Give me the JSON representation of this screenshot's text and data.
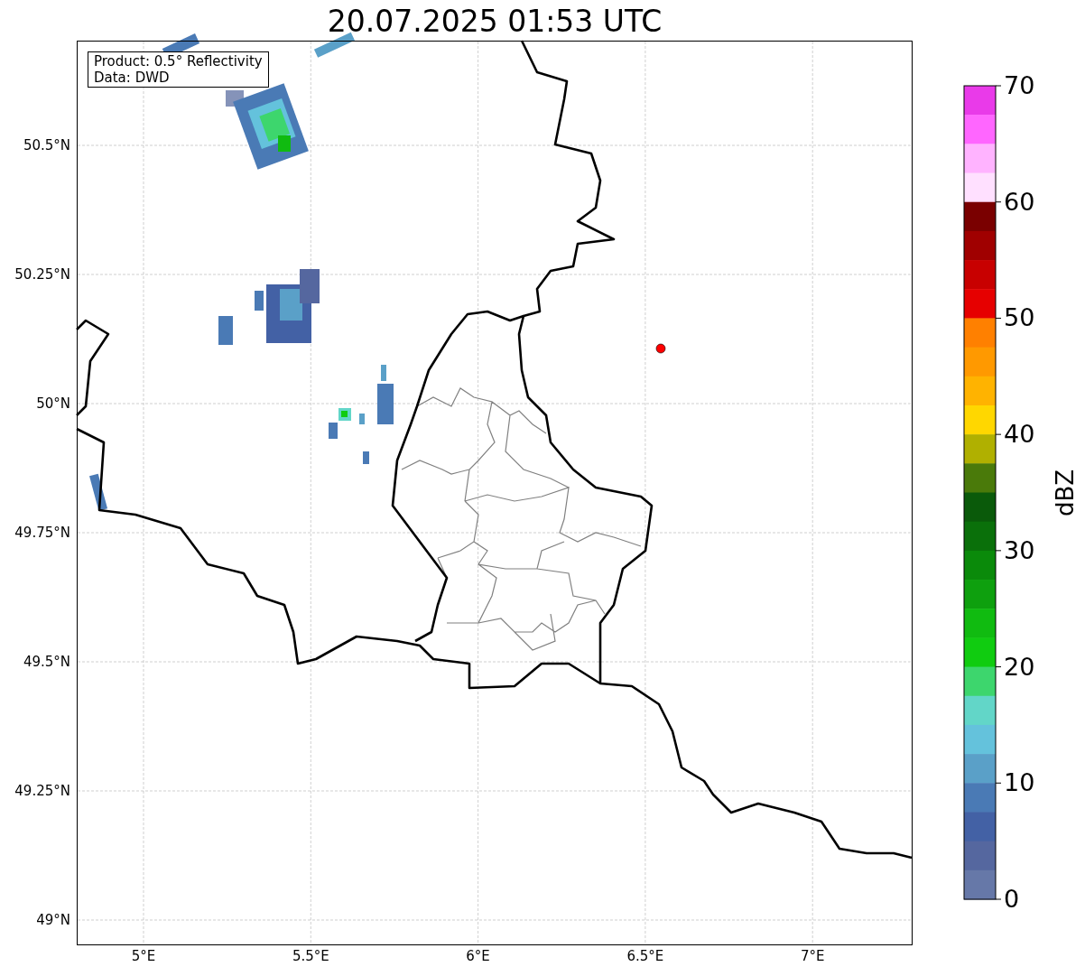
{
  "title": "20.07.2025 01:53 UTC",
  "info_box": {
    "lines": [
      "Product: 0.5° Reflectivity",
      "Data: DWD"
    ]
  },
  "map": {
    "lat_labels": [
      "50.5°N",
      "50.25°N",
      "50°N",
      "49.75°N",
      "49.5°N",
      "49.25°N",
      "49°N"
    ],
    "lon_labels": [
      "5°E",
      "5.5°E",
      "6°E",
      "6.5°E",
      "7°E"
    ]
  },
  "colorbar": {
    "label": "dBZ",
    "ticks": [
      "70",
      "60",
      "50",
      "40",
      "30",
      "20",
      "10",
      "0"
    ],
    "segments": [
      {
        "color": "#e93ae9"
      },
      {
        "color": "#ff66ff"
      },
      {
        "color": "#ffb3ff"
      },
      {
        "color": "#ffe0ff"
      },
      {
        "color": "#7a0000"
      },
      {
        "color": "#a00000"
      },
      {
        "color": "#c80000"
      },
      {
        "color": "#e60000"
      },
      {
        "color": "#ff8000"
      },
      {
        "color": "#ff9900"
      },
      {
        "color": "#ffb300"
      },
      {
        "color": "#ffd700"
      },
      {
        "color": "#b0b000"
      },
      {
        "color": "#4a7a0a"
      },
      {
        "color": "#0a5a0a"
      },
      {
        "color": "#0a700a"
      },
      {
        "color": "#0a8a0a"
      },
      {
        "color": "#0ea00e"
      },
      {
        "color": "#10bb10"
      },
      {
        "color": "#10cc10"
      },
      {
        "color": "#3dd66d"
      },
      {
        "color": "#62d6c8"
      },
      {
        "color": "#64c2dc"
      },
      {
        "color": "#5aa0c8"
      },
      {
        "color": "#4a7ab5"
      },
      {
        "color": "#4361a5"
      },
      {
        "color": "#55679f"
      },
      {
        "color": "#6678a8"
      }
    ]
  }
}
